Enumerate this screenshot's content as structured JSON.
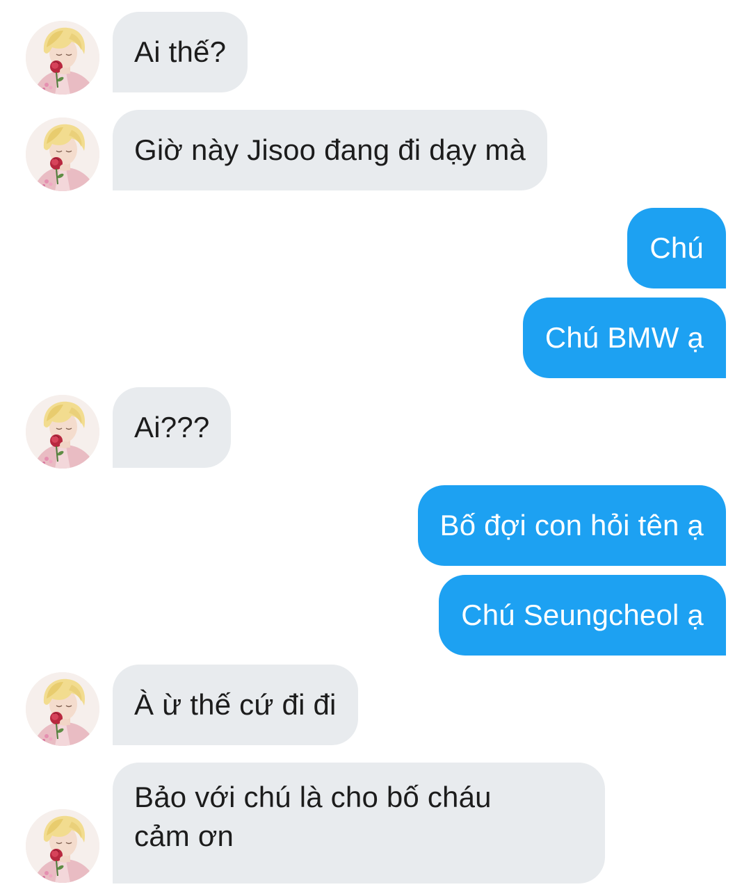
{
  "conversation": {
    "messages": [
      {
        "sender": "them",
        "text": "Ai thế?"
      },
      {
        "sender": "them",
        "text": "Giờ này Jisoo đang đi dạy mà"
      },
      {
        "sender": "me",
        "text": "Chú"
      },
      {
        "sender": "me",
        "text": "Chú BMW ạ"
      },
      {
        "sender": "them",
        "text": "Ai???"
      },
      {
        "sender": "me",
        "text": "Bố đợi con hỏi tên ạ"
      },
      {
        "sender": "me",
        "text": "Chú Seungcheol ạ"
      },
      {
        "sender": "them",
        "text": "À ừ thế cứ đi đi"
      },
      {
        "sender": "them",
        "text_line1": "Bảo với chú là cho bố cháu",
        "text_line2": "cảm ơn"
      }
    ]
  },
  "colors": {
    "incoming_bubble": "#e8ebee",
    "outgoing_bubble": "#1da1f2",
    "incoming_text": "#1c1c1c",
    "outgoing_text": "#ffffff"
  },
  "icons": {
    "avatar": "contact-avatar-photo"
  }
}
